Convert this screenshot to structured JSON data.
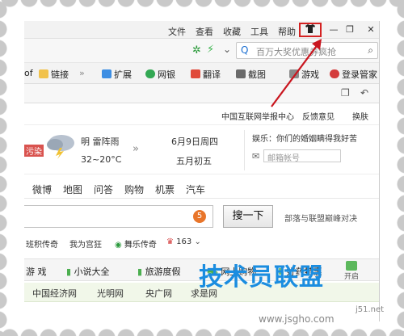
{
  "titlebar": {
    "menus": [
      "文件",
      "查看",
      "收藏",
      "工具",
      "帮助"
    ],
    "skin_icon": "tshirt-icon",
    "minimize": "—",
    "restore": "❐",
    "close": "✕"
  },
  "address": {
    "search_placeholder": "百万大奖优惠券疯抢"
  },
  "favorites": {
    "items": [
      "链接",
      "扩展",
      "网银",
      "翻译",
      "截图",
      "游戏",
      "登录管家"
    ],
    "cut_left": "of"
  },
  "page": {
    "top_links": [
      "中国互联网举报中心",
      "反馈意见",
      "换肤"
    ],
    "weather": {
      "condition": "明 雷阵雨",
      "temp": "32~20°C",
      "date": "6月9日周四",
      "lunar": "五月初五",
      "entertainment": "娱乐：你们的婚姻瞒得我好苦",
      "mail_placeholder": "邮箱帐号",
      "left_cut": "污染"
    },
    "nav": [
      "微博",
      "地图",
      "问答",
      "购物",
      "机票",
      "汽车"
    ],
    "search_button": "搜一下",
    "search_badge": "5",
    "search_hint": "部落与联盟巅峰对决",
    "quick_links": [
      "班积传奇",
      "我为宫狂",
      "舞乐传奇",
      "163"
    ],
    "categories": [
      "游 戏",
      "小说大全",
      "旅游度假",
      "网上购物",
      "好药特惠",
      "开启"
    ],
    "sites": [
      "中国经济网",
      "光明网",
      "央广网",
      "求是网"
    ]
  },
  "watermark": {
    "main": "技术员联盟",
    "url": "www.jsgho.com",
    "side": "j51.net"
  }
}
